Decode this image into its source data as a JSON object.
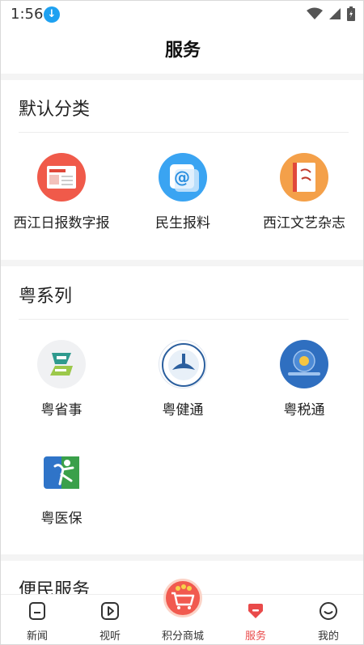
{
  "status_bar": {
    "time": "1:56"
  },
  "header": {
    "title": "服务"
  },
  "sections": {
    "default": {
      "title": "默认分类",
      "items": [
        {
          "label": "西江日报数字报",
          "icon": "newspaper-icon",
          "color": "#f05a4a"
        },
        {
          "label": "民生报料",
          "icon": "at-sign-icon",
          "color": "#3aa4f2"
        },
        {
          "label": "西江文艺杂志",
          "icon": "magazine-icon",
          "color": "#f4a049"
        }
      ]
    },
    "yue": {
      "title": "粤系列",
      "items": [
        {
          "label": "粤省事",
          "icon": "yue-sheng-shi-icon",
          "color": "#2f9a8e"
        },
        {
          "label": "粤健通",
          "icon": "yue-jian-tong-icon",
          "color": "#2b5f9e"
        },
        {
          "label": "粤税通",
          "icon": "yue-shui-tong-icon",
          "color": "#2f6fc0"
        },
        {
          "label": "粤医保",
          "icon": "yue-yi-bao-icon",
          "color": "#3aa04a"
        }
      ]
    },
    "civil": {
      "title": "便民服务"
    }
  },
  "tabs": [
    {
      "label": "新闻",
      "icon": "news-icon"
    },
    {
      "label": "视听",
      "icon": "play-icon"
    },
    {
      "label": "积分商城",
      "icon": "cart-icon"
    },
    {
      "label": "服务",
      "icon": "service-icon",
      "active": true
    },
    {
      "label": "我的",
      "icon": "profile-icon"
    }
  ],
  "colors": {
    "accent": "#e94a4a",
    "section_bg": "#f4f4f4"
  }
}
